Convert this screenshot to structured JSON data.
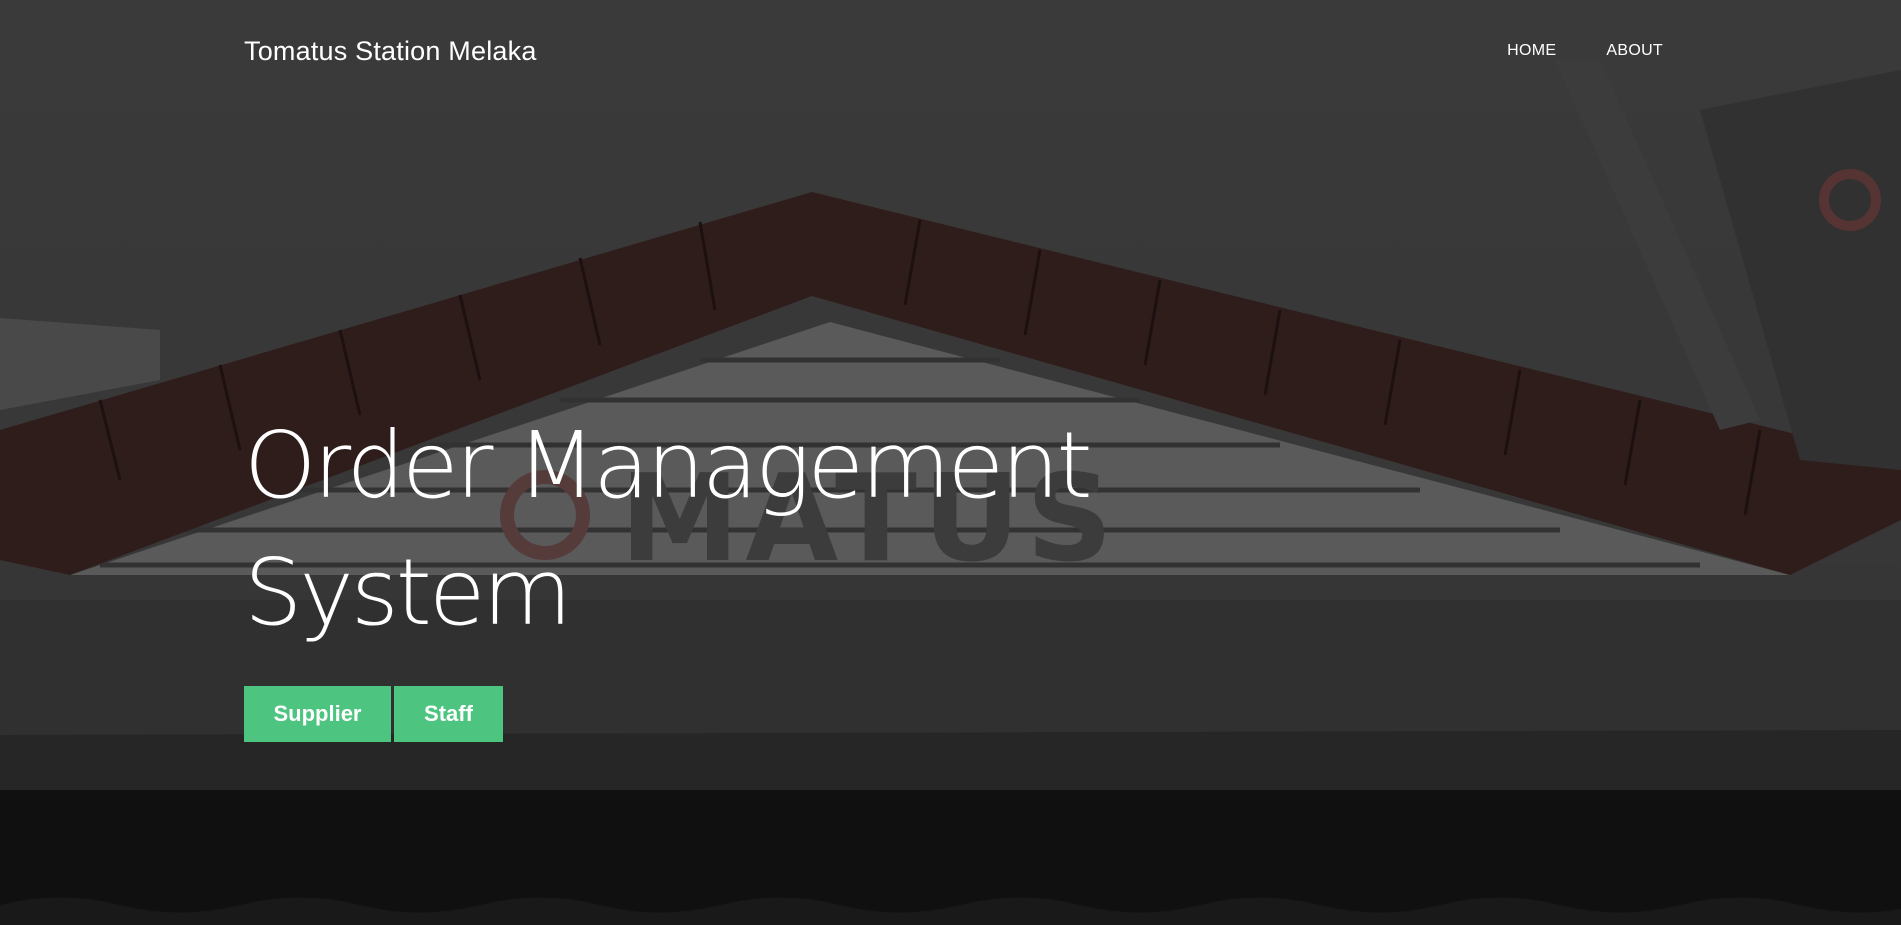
{
  "nav": {
    "brand": "Tomatus Station Melaka",
    "links": [
      "HOME",
      "ABOUT"
    ]
  },
  "hero": {
    "title_line1": "Order Management",
    "title_line2": "System",
    "buttons": [
      "Supplier",
      "Staff"
    ],
    "button_color": "#4dc480"
  },
  "background": {
    "sign_text": "TOMATUS"
  }
}
